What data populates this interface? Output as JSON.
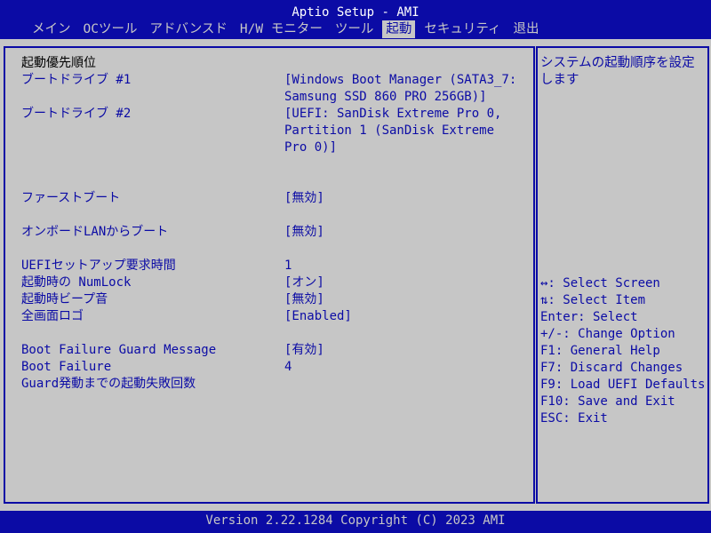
{
  "window": {
    "title": "Aptio Setup - AMI"
  },
  "tabs": [
    {
      "label": "メイン",
      "active": false
    },
    {
      "label": "OCツール",
      "active": false
    },
    {
      "label": "アドバンスド",
      "active": false
    },
    {
      "label": "H/W モニター",
      "active": false
    },
    {
      "label": "ツール",
      "active": false
    },
    {
      "label": "起動",
      "active": true
    },
    {
      "label": "セキュリティ",
      "active": false
    },
    {
      "label": "退出",
      "active": false
    }
  ],
  "section": {
    "heading": "起動優先順位"
  },
  "settings": {
    "boot1": {
      "label": "ブートドライブ #1",
      "value1": "[Windows Boot Manager (SATA3_7:",
      "value2": "Samsung SSD 860 PRO 256GB)]"
    },
    "boot2": {
      "label": "ブートドライブ #2",
      "value1": "[UEFI: SanDisk Extreme Pro 0,",
      "value2": "Partition 1 (SanDisk Extreme",
      "value3": "Pro 0)]"
    },
    "fastboot": {
      "label": "ファーストブート",
      "value": "[無効]"
    },
    "lanboot": {
      "label": "オンボードLANからブート",
      "value": "[無効]"
    },
    "uefi_wait": {
      "label": "UEFIセットアップ要求時間",
      "value": "1"
    },
    "numlock": {
      "label": "起動時の NumLock",
      "value": "[オン]"
    },
    "beep": {
      "label": "起動時ビープ音",
      "value": "[無効]"
    },
    "logo": {
      "label": "全画面ロゴ",
      "value": "[Enabled]"
    },
    "guard_msg": {
      "label": "Boot Failure Guard Message",
      "value": "[有効]"
    },
    "guard_count": {
      "label1": "Boot Failure",
      "label2": "Guard発動までの起動失敗回数",
      "value": "4"
    }
  },
  "help": {
    "description": "システムの起動順序を設定します",
    "keys": [
      "↔: Select Screen",
      "⇅: Select Item",
      "Enter: Select",
      "+/-: Change Option",
      "F1: General Help",
      "F7: Discard Changes",
      "F9: Load UEFI Defaults",
      "F10: Save and Exit",
      "ESC: Exit"
    ]
  },
  "footer": {
    "version": "Version 2.22.1284 Copyright (C) 2023 AMI"
  },
  "colors": {
    "accent": "#0b0ba5",
    "background": "#c6c6c6",
    "text": "#000000"
  }
}
